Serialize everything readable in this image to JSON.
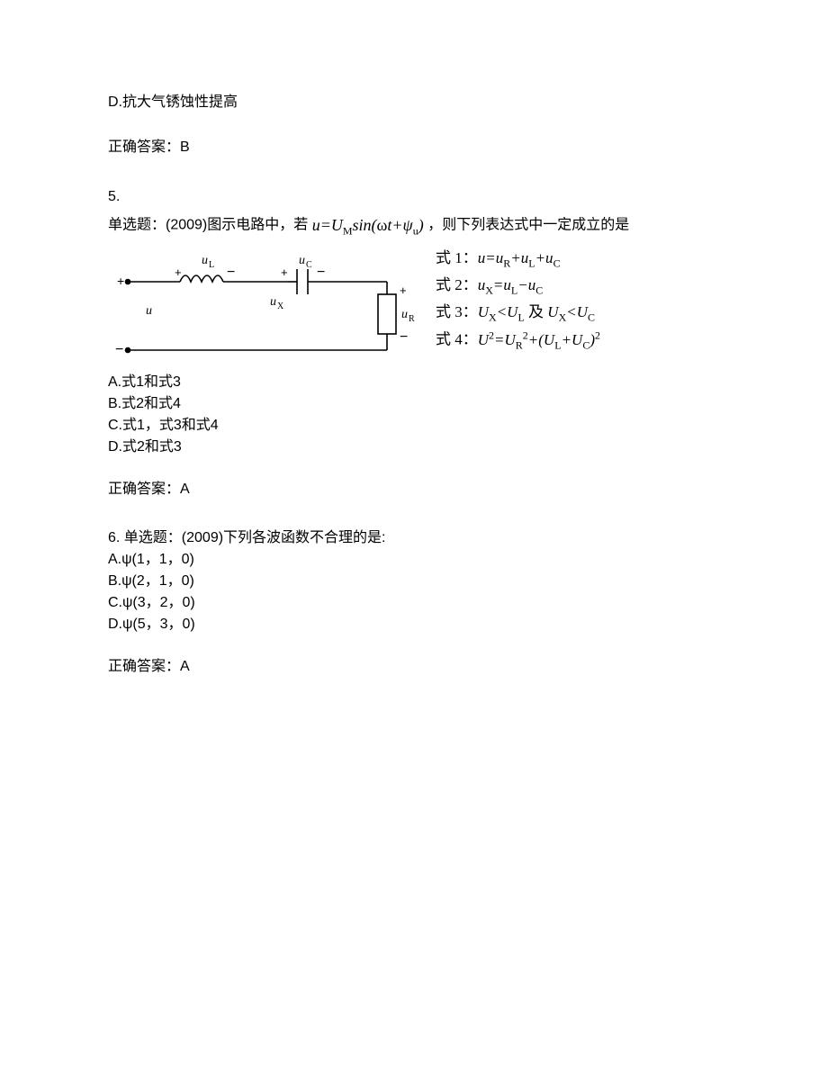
{
  "q4": {
    "option_d": "D.抗大气锈蚀性提高",
    "answer_label": "正确答案：",
    "answer_value": "B"
  },
  "q5": {
    "number": "5.",
    "stem_prefix": "单选题：(2009)图示电路中，若",
    "formula": "u=U_M sin(ωt+ψ_u)",
    "stem_suffix": "，则下列表达式中一定成立的是",
    "eq1_label": "式 1：",
    "eq1_body": "u=u_R+u_L+u_C",
    "eq2_label": "式 2：",
    "eq2_body": "u_X=u_L−u_C",
    "eq3_label": "式 3：",
    "eq3_body": "U_X<U_L 及 U_X<U_C",
    "eq4_label": "式 4：",
    "eq4_body": "U^2=U_R^2+(U_L+U_C)^2",
    "circuit_labels": {
      "uL": "u_L",
      "uC": "u_C",
      "uX": "u_X",
      "uR": "u_R",
      "u": "u"
    },
    "option_a": "A.式1和式3",
    "option_b": "B.式2和式4",
    "option_c": "C.式1，式3和式4",
    "option_d": "D.式2和式3",
    "answer_label": "正确答案：",
    "answer_value": "A"
  },
  "q6": {
    "stem": "6. 单选题：(2009)下列各波函数不合理的是:",
    "option_a": "A.ψ(1，1，0)",
    "option_b": "B.ψ(2，1，0)",
    "option_c": "C.ψ(3，2，0)",
    "option_d": "D.ψ(5，3，0)",
    "answer_label": "正确答案：",
    "answer_value": "A"
  }
}
